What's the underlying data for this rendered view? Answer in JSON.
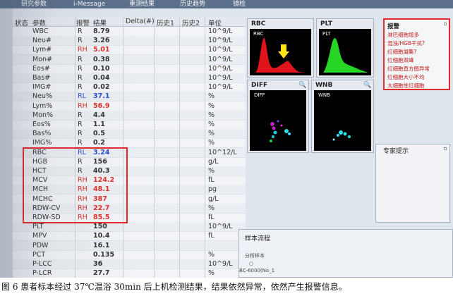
{
  "tabs": [
    "研究参数",
    "i-Message",
    "重测结果",
    "历史趋势",
    "镜检"
  ],
  "table": {
    "headers": [
      "状态",
      "参数",
      "报警",
      "结果",
      "Delta(#)",
      "历史1",
      "历史2",
      "单位"
    ],
    "rows": [
      {
        "name": "WBC",
        "flag": "R",
        "result": "8.79",
        "unit": "10^9/L"
      },
      {
        "name": "Neu#",
        "flag": "R",
        "result": "3.26",
        "unit": "10^9/L"
      },
      {
        "name": "Lym#",
        "flag": "RH",
        "result": "5.01",
        "unit": "10^9/L"
      },
      {
        "name": "Mon#",
        "flag": "R",
        "result": "0.38",
        "unit": "10^9/L"
      },
      {
        "name": "Eos#",
        "flag": "R",
        "result": "0.10",
        "unit": "10^9/L"
      },
      {
        "name": "Bas#",
        "flag": "R",
        "result": "0.04",
        "unit": "10^9/L"
      },
      {
        "name": "IMG#",
        "flag": "R",
        "result": "0.02",
        "unit": "10^9/L"
      },
      {
        "name": "Neu%",
        "flag": "RL",
        "result": "37.1",
        "unit": "%"
      },
      {
        "name": "Lym%",
        "flag": "RH",
        "result": "56.9",
        "unit": "%"
      },
      {
        "name": "Mon%",
        "flag": "R",
        "result": "4.4",
        "unit": "%"
      },
      {
        "name": "Eos%",
        "flag": "R",
        "result": "1.1",
        "unit": "%"
      },
      {
        "name": "Bas%",
        "flag": "R",
        "result": "0.5",
        "unit": "%"
      },
      {
        "name": "IMG%",
        "flag": "R",
        "result": "0.2",
        "unit": "%"
      },
      {
        "name": "RBC",
        "flag": "RL",
        "result": "3.24",
        "unit": "10^12/L"
      },
      {
        "name": "HGB",
        "flag": "R",
        "result": "156",
        "unit": "g/L"
      },
      {
        "name": "HCT",
        "flag": "R",
        "result": "40.3",
        "unit": "%"
      },
      {
        "name": "MCV",
        "flag": "RH",
        "result": "124.2",
        "unit": "fL"
      },
      {
        "name": "MCH",
        "flag": "RH",
        "result": "48.1",
        "unit": "pg"
      },
      {
        "name": "MCHC",
        "flag": "RH",
        "result": "387",
        "unit": "g/L"
      },
      {
        "name": "RDW-CV",
        "flag": "RH",
        "result": "22.7",
        "unit": "%"
      },
      {
        "name": "RDW-SD",
        "flag": "RH",
        "result": "85.5",
        "unit": "fL"
      },
      {
        "name": "PLT",
        "flag": "",
        "result": "150",
        "unit": "10^9/L"
      },
      {
        "name": "MPV",
        "flag": "",
        "result": "10.4",
        "unit": "fL"
      },
      {
        "name": "PDW",
        "flag": "",
        "result": "16.1",
        "unit": ""
      },
      {
        "name": "PCT",
        "flag": "",
        "result": "0.135",
        "unit": "%"
      },
      {
        "name": "P-LCC",
        "flag": "",
        "result": "36",
        "unit": "10^9/L"
      },
      {
        "name": "P-LCR",
        "flag": "",
        "result": "27.7",
        "unit": "%"
      }
    ]
  },
  "histograms": {
    "rbc": {
      "title": "RBC",
      "inner_label": "RBC"
    },
    "plt": {
      "title": "PLT",
      "inner_label": "PLT"
    },
    "diff": {
      "title": "DIFF",
      "inner_label": "DIFF"
    },
    "wnb": {
      "title": "WNB",
      "inner_label": "WNB"
    }
  },
  "alarm": {
    "title": "报警",
    "messages": [
      "淋巴细胞增多",
      "混浊/HGB干扰?",
      "红细胞凝集?",
      "红细胞双峰",
      "红细胞直方图异常",
      "红细胞大小不均",
      "大细胞性红细胞"
    ]
  },
  "expert": {
    "title": "专家提示"
  },
  "flow": {
    "title": "样本流程",
    "step": "分析样本",
    "device": "BC-6000(No_1"
  },
  "caption": "图 6  患者标本经过 37℃温浴 30min 后上机检测结果，结果依然异常，依然产生报警信息。",
  "colors": {
    "flag_high": "#e0302a",
    "flag_low": "#2b4fd0",
    "highlight_border": "#e32b2b"
  }
}
